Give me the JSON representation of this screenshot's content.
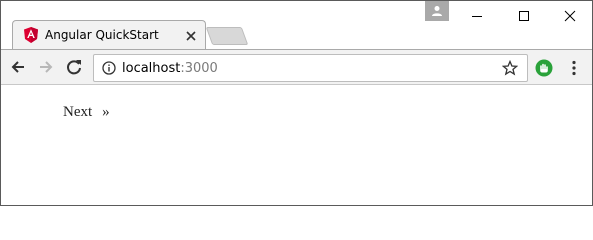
{
  "browser": {
    "tab": {
      "title": "Angular QuickStart",
      "favicon": "angular-logo-icon",
      "favicon_color": "#dd0031"
    },
    "window_controls": [
      "minimize-icon",
      "maximize-icon",
      "close-icon"
    ],
    "profile_icon": "person-icon",
    "toolbar": {
      "back_icon": "arrow-left-icon",
      "forward_icon": "arrow-right-icon",
      "reload_icon": "reload-icon",
      "info_icon": "info-icon",
      "url_host": "localhost",
      "url_port": ":3000",
      "bookmark_icon": "star-icon",
      "extension_icon": "hand-icon",
      "extension_color": "#2aa23a",
      "menu_icon": "kebab-menu-icon"
    }
  },
  "page": {
    "pager": {
      "next_label": "Next",
      "arrow": "»"
    }
  }
}
